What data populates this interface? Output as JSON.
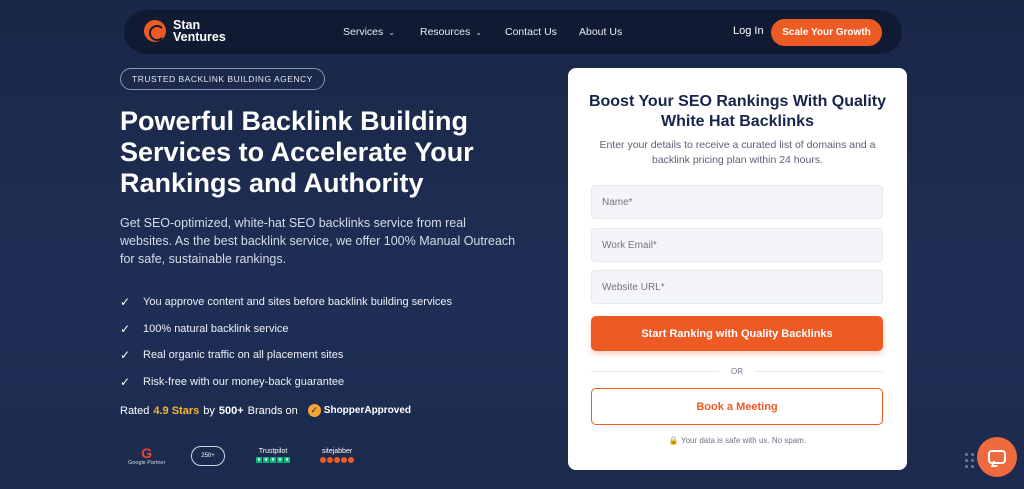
{
  "nav": {
    "brand": "Stan Ventures",
    "brand_line1": "Stan",
    "brand_line2": "Ventures",
    "links": [
      "Services",
      "Resources",
      "Contact Us",
      "About Us"
    ],
    "login": "Log In",
    "cta": "Scale Your Growth"
  },
  "hero": {
    "badge": "TRUSTED BACKLINK BUILDING AGENCY",
    "title": "Powerful Backlink Building Services to Accelerate Your Rankings and Authority",
    "subtitle": "Get SEO-optimized, white-hat SEO backlinks service from real websites. As the best backlink service, we offer 100% Manual Outreach for safe, sustainable rankings.",
    "checks": [
      "You approve content and sites before backlink building services",
      "100% natural backlink service",
      "Real organic traffic on all placement sites",
      "Risk-free with our money-back guarantee"
    ],
    "rated_prefix": "Rated",
    "rated_stars": "4.9 Stars",
    "rated_by": "by",
    "rated_brands": "500+",
    "rated_suffix": "Brands on",
    "shopper_approved": "ShopperApproved",
    "trust": {
      "google": "Google Partner",
      "clutch": "250+",
      "trustpilot": "Trustpilot",
      "sitejabber": "sitejabber"
    }
  },
  "form": {
    "title": "Boost Your SEO Rankings With Quality White Hat Backlinks",
    "subtitle": "Enter your details to receive a curated list of domains and a backlink pricing plan within 24 hours.",
    "name_placeholder": "Name*",
    "email_placeholder": "Work Email*",
    "url_placeholder": "Website URL*",
    "submit": "Start Ranking with Quality Backlinks",
    "or": "OR",
    "meeting": "Book a Meeting",
    "safe_note": "Your data is safe with us. No spam."
  },
  "colors": {
    "accent": "#ee5a24",
    "background": "#1c2a4d",
    "nav": "#111a33",
    "star": "#f7b731"
  }
}
